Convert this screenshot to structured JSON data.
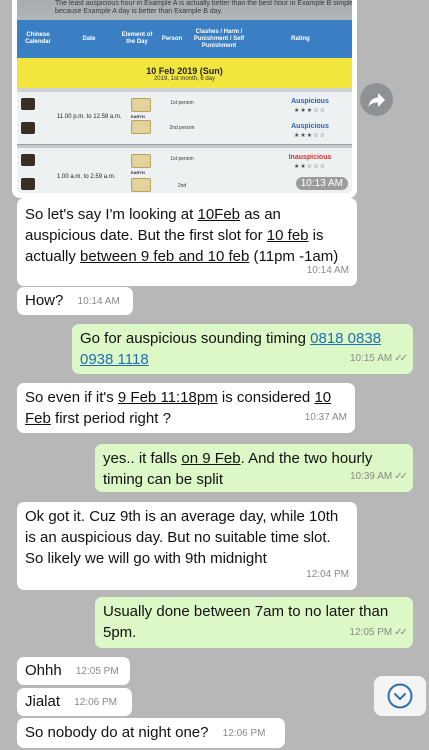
{
  "image_message": {
    "top_text_line1": "The least auspicious hour in Example A is actually better than the best hour in Example B simple",
    "top_text_line2": "because Example A day is better than Example B day.",
    "header": {
      "col_calendar": "Chinese Calendar",
      "col_date": "Date",
      "col_element": "Element of the Day",
      "col_person": "Person",
      "col_clashes": "Clashes / Harm / Punishment / Self Punishment",
      "col_rating": "Rating"
    },
    "date_banner_main": "10 Feb 2019 (Sun)",
    "date_banner_sub": "2019, 1st month, 6 day",
    "rows": [
      {
        "time": "11.00 p.m. to 12.59 a.m.",
        "element": "EARTH",
        "p1": "1st person",
        "p2": "2nd person",
        "r1": "Auspicious",
        "r2": "Auspicious",
        "s1": "★★★☆☆",
        "s2": "★★★☆☆"
      },
      {
        "time": "1.00 a.m. to 2.59 a.m.",
        "element": "EARTH",
        "p1": "1st person",
        "p2": "2nd",
        "r1": "Inauspicious",
        "r2": "",
        "s1": "★★☆☆☆",
        "s2": ""
      }
    ],
    "timestamp": "10:13 AM"
  },
  "messages": [
    {
      "id": "m1",
      "dir": "in",
      "parts": [
        "So let's say I'm looking at ",
        "10Feb",
        " as an auspicious date. But the first slot for ",
        "10 feb",
        " is actually ",
        "between 9 feb and 10 feb",
        " (11pm -1am)"
      ],
      "time": "10:14 AM"
    },
    {
      "id": "m2",
      "dir": "in",
      "text": "How?",
      "time": "10:14 AM"
    },
    {
      "id": "m3",
      "dir": "out",
      "text": "Go for auspicious sounding timing ",
      "link": "0818 0838 0938 1118",
      "time": "10:15 AM"
    },
    {
      "id": "m4",
      "dir": "in",
      "parts": [
        "So even if it's ",
        "9 Feb 11:18pm",
        " is considered ",
        "10 Feb",
        " first period right ?"
      ],
      "time": "10:37 AM"
    },
    {
      "id": "m5",
      "dir": "out",
      "parts": [
        "yes.. it falls ",
        "on 9 Feb",
        ". And the two hourly timing can be split"
      ],
      "time": "10:39 AM"
    },
    {
      "id": "m6",
      "dir": "in",
      "text": "Ok got it. Cuz 9th is an average day, while 10th is an auspicious day. But no suitable time slot. So likely we will go with 9th midnight",
      "time": "12:04 PM"
    },
    {
      "id": "m7",
      "dir": "out",
      "text": "Usually done between 7am to no later than 5pm.",
      "time": "12:05 PM"
    },
    {
      "id": "m8",
      "dir": "in",
      "text": "Ohhh",
      "time": "12:05 PM"
    },
    {
      "id": "m9",
      "dir": "in",
      "text": "Jialat",
      "time": "12:06 PM"
    },
    {
      "id": "m10",
      "dir": "in",
      "text": "So nobody do at night one?",
      "time": "12:06 PM"
    }
  ],
  "icons": {
    "forward": "forward-icon",
    "scroll_down": "chevron-down-icon",
    "read_ticks": "double-check-icon"
  },
  "colors": {
    "chat_background": "#b7b7b7",
    "incoming_bubble": "#ffffff",
    "outgoing_bubble": "#dcf8c6",
    "link": "#1f6db4",
    "scroll_icon": "#2f6fb3"
  }
}
